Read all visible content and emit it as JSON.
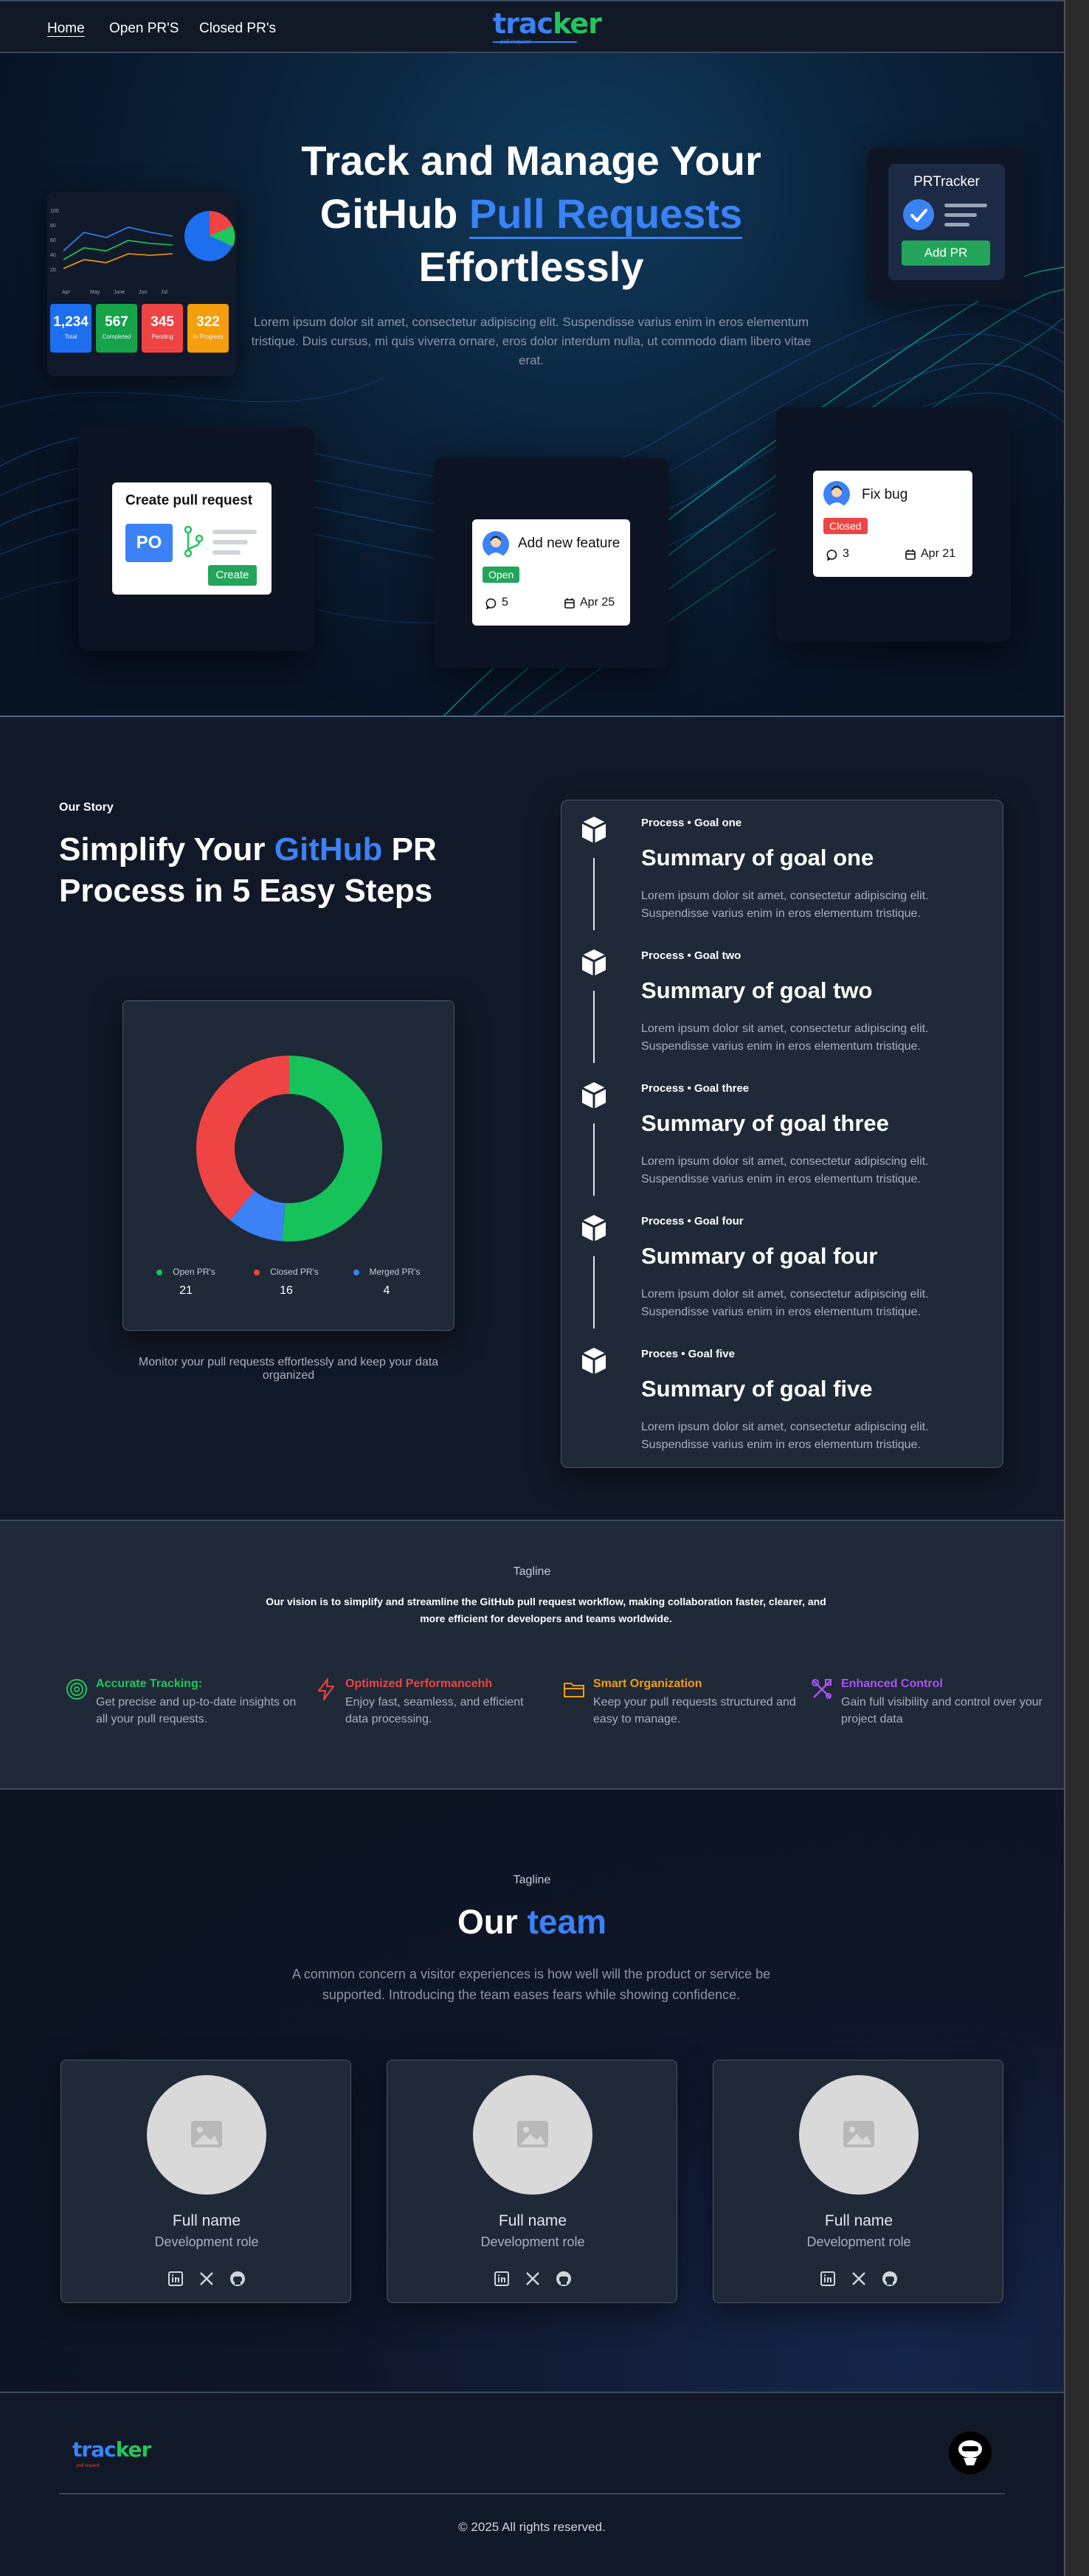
{
  "nav": {
    "links": [
      "Home",
      "Open PR'S",
      "Closed PR's"
    ],
    "logo_a": "trac",
    "logo_b": "ker",
    "logo_sub": "pull request"
  },
  "hero": {
    "title_line1": "Track and Manage Your",
    "title_line2_a": "GitHub ",
    "title_line2_b": "Pull Requests",
    "title_line3": "Effortlessly",
    "description": "Lorem ipsum dolor sit amet, consectetur adipiscing elit. Suspendisse varius enim in eros elementum tristique. Duis cursus, mi quis viverra ornare, eros dolor interdum nulla, ut commodo diam libero vitae erat.",
    "dash": {
      "axis": [
        "100",
        "80",
        "60",
        "40",
        "20"
      ],
      "months": [
        "Apr",
        "May",
        "June",
        "Jun",
        "Jul"
      ],
      "stats": [
        {
          "value": "1,234",
          "label": "Total",
          "color": "#1e6ef0"
        },
        {
          "value": "567",
          "label": "Completed",
          "color": "#16a34a"
        },
        {
          "value": "345",
          "label": "Pending",
          "color": "#ef4444"
        },
        {
          "value": "322",
          "label": "In Progress",
          "color": "#f59e0b"
        }
      ]
    },
    "prtracker": {
      "title": "PRTracker",
      "button": "Add PR"
    },
    "create_card": {
      "title": "Create pull request",
      "badge": "PO",
      "button": "Create"
    },
    "feature_card": {
      "title": "Add new feature",
      "status": "Open",
      "comments": "5",
      "date": "Apr 25"
    },
    "bug_card": {
      "title": "Fix bug",
      "status": "Closed",
      "comments": "3",
      "date": "Apr 21"
    }
  },
  "story": {
    "eyebrow": "Our Story",
    "title_a": "Simplify Your ",
    "title_b": "GitHub",
    "title_c": " PR",
    "title_line2": "Process in 5 Easy Steps",
    "donut": {
      "legend": [
        {
          "label": "Open PR's",
          "value": "21",
          "color": "#16c25a"
        },
        {
          "label": "Closed PR's",
          "value": "16",
          "color": "#ef4444"
        },
        {
          "label": "Merged PR's",
          "value": "4",
          "color": "#3b82f6"
        }
      ]
    },
    "caption": "Monitor your pull requests effortlessly and keep your data organized",
    "steps": [
      {
        "kicker": "Process • Goal one",
        "title": "Summary of goal one",
        "desc": "Lorem ipsum dolor sit amet, consectetur adipiscing elit. Suspendisse varius enim in eros elementum tristique."
      },
      {
        "kicker": "Process • Goal two",
        "title": "Summary of goal two",
        "desc": "Lorem ipsum dolor sit amet, consectetur adipiscing elit. Suspendisse varius enim in eros elementum tristique."
      },
      {
        "kicker": "Process • Goal three",
        "title": "Summary of goal three",
        "desc": "Lorem ipsum dolor sit amet, consectetur adipiscing elit. Suspendisse varius enim in eros elementum tristique."
      },
      {
        "kicker": "Process • Goal four",
        "title": "Summary of goal four",
        "desc": "Lorem ipsum dolor sit amet, consectetur adipiscing elit. Suspendisse varius enim in eros elementum tristique."
      },
      {
        "kicker": "Proces • Goal five",
        "title": "Summary of goal five",
        "desc": "Lorem ipsum dolor sit amet, consectetur adipiscing elit. Suspendisse varius enim in eros elementum tristique."
      }
    ]
  },
  "tagline": {
    "eyebrow": "Tagline",
    "vision": "Our vision is to simplify and streamline the GitHub pull request workflow, making collaboration faster, clearer, and more efficient for developers and teams worldwide.",
    "features": [
      {
        "icon": "target-icon",
        "title": "Accurate Tracking:",
        "desc": "Get precise and up-to-date insights on all your pull requests.",
        "color": "#22c55e"
      },
      {
        "icon": "lightning-icon",
        "title": "Optimized Performancehh",
        "desc": "Enjoy fast, seamless, and efficient data processing.",
        "color": "#ef4444"
      },
      {
        "icon": "folder-icon",
        "title": "Smart Organization",
        "desc": "Keep your pull requests structured and easy to manage.",
        "color": "#f59e0b"
      },
      {
        "icon": "tools-icon",
        "title": "Enhanced Control",
        "desc": "Gain full visibility and control over your project data",
        "color": "#a855f7"
      }
    ]
  },
  "team": {
    "eyebrow": "Tagline",
    "title_a": "Our ",
    "title_b": "team",
    "desc": "A common concern a visitor experiences is how well will the product or service be supported. Introducing the team eases fears while showing confidence.",
    "members": [
      {
        "name": "Full name",
        "role": "Development role"
      },
      {
        "name": "Full name",
        "role": "Development role"
      },
      {
        "name": "Full name",
        "role": "Development role"
      }
    ]
  },
  "footer": {
    "logo_a": "trac",
    "logo_b": "ker",
    "logo_sub": "pull request",
    "copyright": "© 2025  All rights reserved."
  }
}
